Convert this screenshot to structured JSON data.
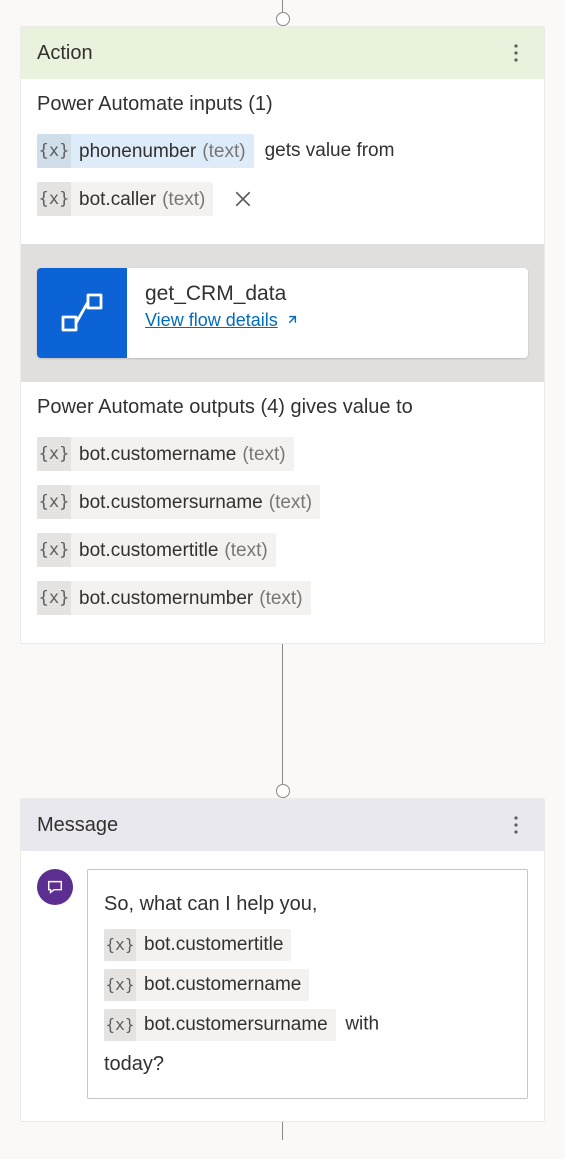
{
  "action": {
    "title": "Action",
    "inputs_label": "Power Automate inputs (1)",
    "input_token": {
      "name": "phonenumber",
      "type": "(text)"
    },
    "gets_text": "gets value from",
    "source_token": {
      "name": "bot.caller",
      "type": "(text)"
    },
    "flow": {
      "name": "get_CRM_data",
      "link_label": "View flow details"
    },
    "outputs_label": "Power Automate outputs (4) gives value to",
    "outputs": [
      {
        "name": "bot.customername",
        "type": "(text)"
      },
      {
        "name": "bot.customersurname",
        "type": "(text)"
      },
      {
        "name": "bot.customertitle",
        "type": "(text)"
      },
      {
        "name": "bot.customernumber",
        "type": "(text)"
      }
    ]
  },
  "message": {
    "title": "Message",
    "text_before": "So, what can I help you,",
    "tokens": [
      {
        "name": "bot.customertitle"
      },
      {
        "name": "bot.customername"
      },
      {
        "name": "bot.customersurname"
      }
    ],
    "with_text": "with",
    "text_after": "today?"
  },
  "glyphs": {
    "x": "{x}"
  }
}
